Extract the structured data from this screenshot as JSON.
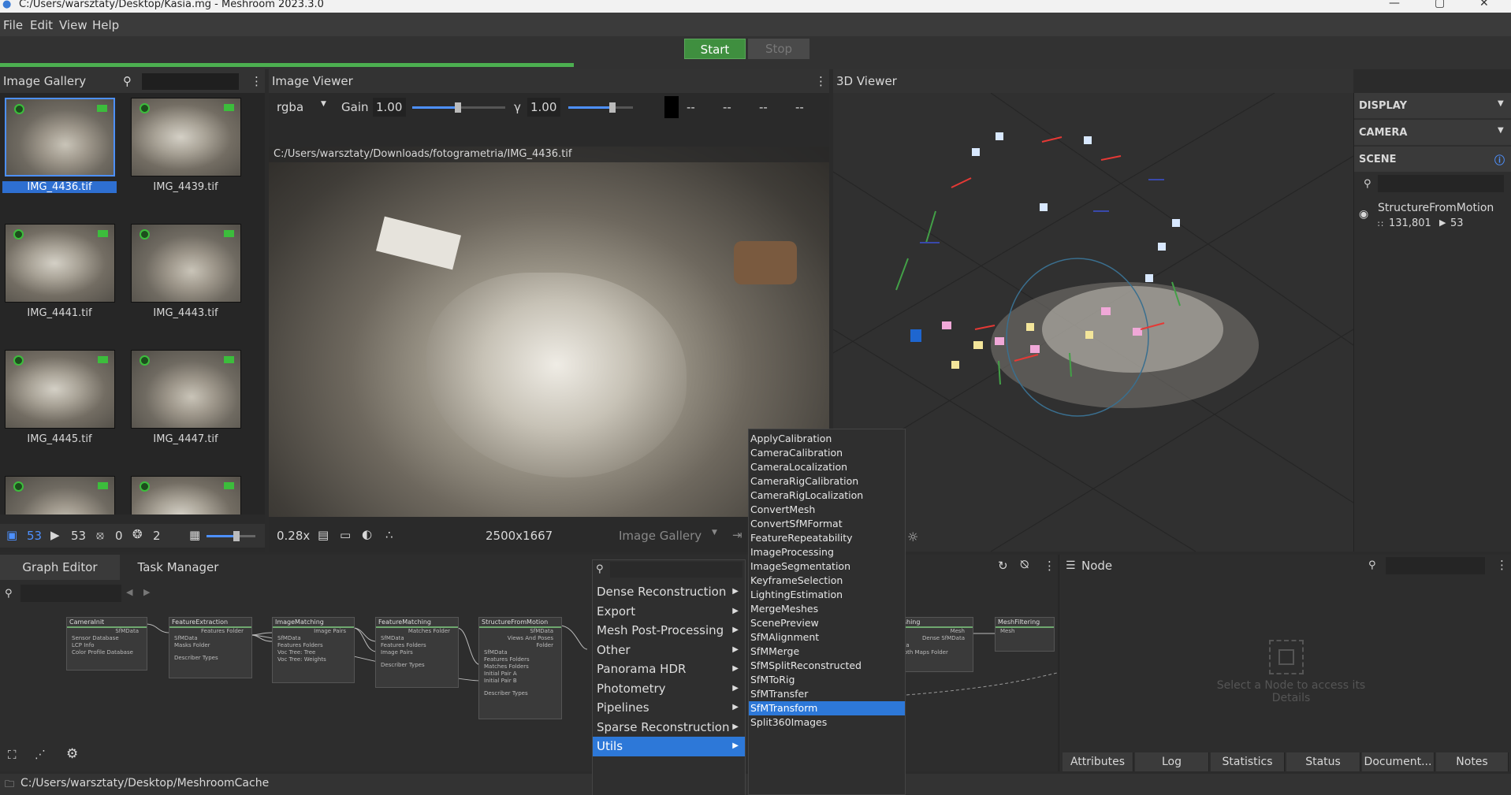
{
  "window": {
    "title": "C:/Users/warsztaty/Desktop/Kasia.mg - Meshroom 2023.3.0",
    "minimize": "—",
    "maximize": "▢",
    "close": "✕"
  },
  "menu": {
    "file": "File",
    "edit": "Edit",
    "view": "View",
    "help": "Help"
  },
  "run": {
    "start": "Start",
    "stop": "Stop",
    "progress": 0.38
  },
  "gallery": {
    "title": "Image Gallery",
    "images": [
      {
        "name": "IMG_4436.tif",
        "selected": true
      },
      {
        "name": "IMG_4439.tif"
      },
      {
        "name": "IMG_4441.tif"
      },
      {
        "name": "IMG_4443.tif"
      },
      {
        "name": "IMG_4445.tif"
      },
      {
        "name": "IMG_4447.tif"
      },
      {
        "name": ""
      },
      {
        "name": ""
      }
    ],
    "footer": {
      "images": "53",
      "cameras": "53",
      "no_cameras": "0",
      "intrinsics": "2"
    }
  },
  "viewer": {
    "title": "Image Viewer",
    "channel": "rgba",
    "gain_label": "Gain",
    "gain": "1.00",
    "gamma_label": "γ",
    "gamma": "1.00",
    "pixel_vals": [
      "--",
      "--",
      "--",
      "--"
    ],
    "path": "C:/Users/warsztaty/Downloads/fotogrametria/IMG_4436.tif",
    "zoom": "0.28x",
    "resolution": "2500x1667",
    "source": "Image Gallery"
  },
  "viewer3d": {
    "title": "3D Viewer"
  },
  "sidepanel": {
    "display": "DISPLAY",
    "camera": "CAMERA",
    "scene": "SCENE",
    "item": "StructureFromMotion",
    "points": "131,801",
    "cams": "53"
  },
  "graph": {
    "tab1": "Graph Editor",
    "tab2": "Task Manager",
    "nodes": [
      {
        "title": "CameraInit",
        "rows": [
          "SfMData",
          "Sensor Database",
          "LCP Info",
          "Color Profile Database"
        ]
      },
      {
        "title": "FeatureExtraction",
        "rows": [
          "Features Folder",
          "SfMData",
          "Masks Folder",
          "Describer Types"
        ]
      },
      {
        "title": "ImageMatching",
        "rows": [
          "Image Pairs",
          "SfMData",
          "Features Folders",
          "Voc Tree: Tree",
          "Voc Tree: Weights"
        ]
      },
      {
        "title": "FeatureMatching",
        "rows": [
          "Matches Folder",
          "SfMData",
          "Features Folders",
          "Image Pairs",
          "Describer Types"
        ]
      },
      {
        "title": "StructureFromMotion",
        "rows": [
          "SfMData",
          "Views And Poses",
          "Folder",
          "SfMData",
          "Features Folders",
          "Matches Folders",
          "Initial Pair A",
          "Initial Pair B",
          "Describer Types"
        ]
      },
      {
        "title": "Meshing",
        "rows": [
          "Mesh",
          "Dense SfMData",
          "Data",
          "Depth Maps Folder"
        ]
      },
      {
        "title": "MeshFiltering",
        "rows": [
          "Mesh"
        ]
      }
    ],
    "cache": "C:/Users/warsztaty/Desktop/MeshroomCache"
  },
  "node_panel": {
    "title": "Node",
    "hint": "Select a Node to access its Details",
    "tabs": [
      "Attributes",
      "Log",
      "Statistics",
      "Status",
      "Document...",
      "Notes"
    ]
  },
  "context_menu": {
    "items": [
      "Dense Reconstruction",
      "Export",
      "Mesh Post-Processing",
      "Other",
      "Panorama HDR",
      "Photometry",
      "Pipelines",
      "Sparse Reconstruction",
      "Utils"
    ],
    "highlighted": "Utils"
  },
  "submenu": {
    "items": [
      "ApplyCalibration",
      "CameraCalibration",
      "CameraLocalization",
      "CameraRigCalibration",
      "CameraRigLocalization",
      "ConvertMesh",
      "ConvertSfMFormat",
      "FeatureRepeatability",
      "ImageProcessing",
      "ImageSegmentation",
      "KeyframeSelection",
      "LightingEstimation",
      "MergeMeshes",
      "ScenePreview",
      "SfMAlignment",
      "SfMMerge",
      "SfMSplitReconstructed",
      "SfMToRig",
      "SfMTransfer",
      "SfMTransform",
      "Split360Images"
    ],
    "highlighted": "SfMTransform"
  }
}
